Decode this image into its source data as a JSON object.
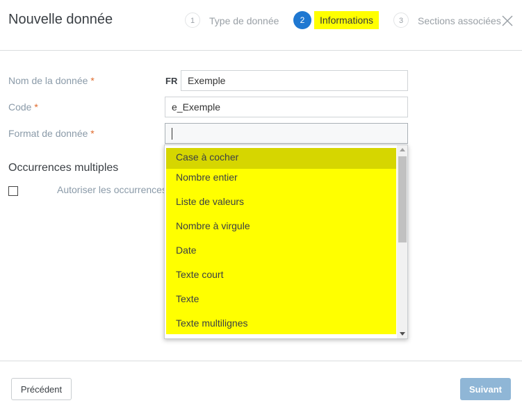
{
  "header": {
    "title": "Nouvelle donnée",
    "steps": [
      {
        "number": "1",
        "label": "Type de donnée",
        "state": "inactive"
      },
      {
        "number": "2",
        "label": "Informations",
        "state": "active"
      },
      {
        "number": "3",
        "label": "Sections associées",
        "state": "inactive"
      }
    ],
    "close_icon": "close-icon"
  },
  "form": {
    "name": {
      "label": "Nom de la donnée",
      "required": "*",
      "lang": "FR",
      "value": "Exemple"
    },
    "code": {
      "label": "Code",
      "required": "*",
      "value": "e_Exemple"
    },
    "format": {
      "label": "Format de donnée",
      "required": "*",
      "value": "",
      "options": [
        "Case à cocher",
        "Nombre entier",
        "Liste de valeurs",
        "Nombre à virgule",
        "Date",
        "Texte court",
        "Texte",
        "Texte multilignes"
      ],
      "highlighted_index": 0
    },
    "multiple": {
      "section_title": "Occurrences multiples",
      "checkbox_label": "Autoriser les occurrences multiples",
      "checked": false
    }
  },
  "footer": {
    "prev_label": "Précédent",
    "next_label": "Suivant"
  },
  "colors": {
    "accent": "#1f78d1",
    "highlight": "#ffff00",
    "next_button": "#8fb6d6",
    "required": "#e06a2c"
  }
}
